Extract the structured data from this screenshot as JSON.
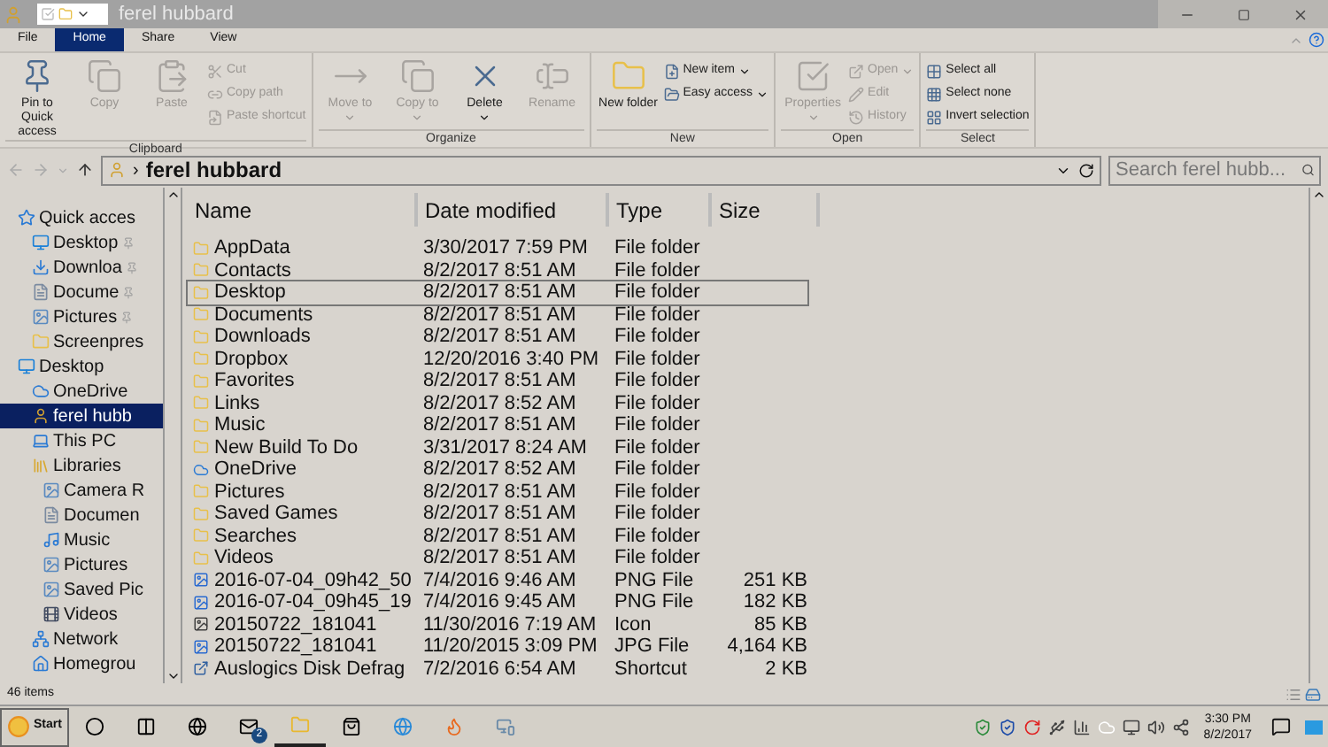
{
  "window": {
    "title": "ferel hubbard"
  },
  "ribbon_tabs": [
    {
      "label": "File",
      "selected": false
    },
    {
      "label": "Home",
      "selected": true
    },
    {
      "label": "Share",
      "selected": false
    },
    {
      "label": "View",
      "selected": false
    }
  ],
  "ribbon_groups": [
    {
      "label": "Clipboard",
      "commands": [
        {
          "kind": "large",
          "label": "Pin to Quick access",
          "disabled": false,
          "menu": false
        },
        {
          "kind": "large",
          "label": "Copy",
          "disabled": true,
          "menu": false
        },
        {
          "kind": "large",
          "label": "Paste",
          "disabled": true,
          "menu": false
        },
        {
          "kind": "small",
          "label": "Cut",
          "disabled": true,
          "menu": false
        },
        {
          "kind": "small",
          "label": "Copy path",
          "disabled": true,
          "menu": false
        },
        {
          "kind": "small",
          "label": "Paste shortcut",
          "disabled": true,
          "menu": false
        }
      ]
    },
    {
      "label": "Organize",
      "commands": [
        {
          "kind": "large",
          "label": "Move to",
          "disabled": true,
          "menu": true
        },
        {
          "kind": "large",
          "label": "Copy to",
          "disabled": true,
          "menu": true
        },
        {
          "kind": "large",
          "label": "Delete",
          "disabled": false,
          "menu": true
        },
        {
          "kind": "large",
          "label": "Rename",
          "disabled": true,
          "menu": false
        }
      ]
    },
    {
      "label": "New",
      "commands": [
        {
          "kind": "large",
          "label": "New folder",
          "disabled": false,
          "menu": false
        },
        {
          "kind": "small",
          "label": "New item",
          "disabled": false,
          "menu": true
        },
        {
          "kind": "small",
          "label": "Easy access",
          "disabled": false,
          "menu": true
        }
      ]
    },
    {
      "label": "Open",
      "commands": [
        {
          "kind": "large",
          "label": "Properties",
          "disabled": true,
          "menu": true
        },
        {
          "kind": "small",
          "label": "Open",
          "disabled": true,
          "menu": true
        },
        {
          "kind": "small",
          "label": "Edit",
          "disabled": true,
          "menu": false
        },
        {
          "kind": "small",
          "label": "History",
          "disabled": true,
          "menu": false
        }
      ]
    },
    {
      "label": "Select",
      "commands": [
        {
          "kind": "small",
          "label": "Select all",
          "disabled": false,
          "menu": false
        },
        {
          "kind": "small",
          "label": "Select none",
          "disabled": false,
          "menu": false
        },
        {
          "kind": "small",
          "label": "Invert selection",
          "disabled": false,
          "menu": false
        }
      ]
    }
  ],
  "address": {
    "separator": "›",
    "path": "ferel hubbard"
  },
  "search": {
    "placeholder": "Search ferel hubb..."
  },
  "nav_tree": [
    {
      "label": "Quick acces",
      "selected": false,
      "children": [
        {
          "label": "Desktop",
          "pinned": true,
          "selected": false
        },
        {
          "label": "Downloa",
          "pinned": true,
          "selected": false
        },
        {
          "label": "Docume",
          "pinned": true,
          "selected": false
        },
        {
          "label": "Pictures",
          "pinned": true,
          "selected": false
        },
        {
          "label": "Screenpres",
          "pinned": false,
          "selected": false
        }
      ]
    },
    {
      "label": "Desktop",
      "selected": false,
      "children": [
        {
          "label": "OneDrive",
          "selected": false
        },
        {
          "label": "ferel hubb",
          "selected": true
        },
        {
          "label": "This PC",
          "selected": false
        },
        {
          "label": "Libraries",
          "selected": false,
          "children": [
            {
              "label": "Camera R",
              "selected": false
            },
            {
              "label": "Documen",
              "selected": false
            },
            {
              "label": "Music",
              "selected": false
            },
            {
              "label": "Pictures",
              "selected": false
            },
            {
              "label": "Saved Pic",
              "selected": false
            },
            {
              "label": "Videos",
              "selected": false
            }
          ]
        },
        {
          "label": "Network",
          "selected": false
        },
        {
          "label": "Homegrou",
          "selected": false
        }
      ]
    }
  ],
  "table": {
    "columns": [
      "Name",
      "Date modified",
      "Type",
      "Size"
    ],
    "rows": [
      {
        "kind": "folder",
        "name": "AppData",
        "date": "3/30/2017 7:59 PM",
        "type": "File folder",
        "selected": false
      },
      {
        "kind": "folder",
        "name": "Contacts",
        "date": "8/2/2017 8:51 AM",
        "type": "File folder",
        "selected": false
      },
      {
        "kind": "folder",
        "name": "Desktop",
        "date": "8/2/2017 8:51 AM",
        "type": "File folder",
        "selected": true
      },
      {
        "kind": "folder",
        "name": "Documents",
        "date": "8/2/2017 8:51 AM",
        "type": "File folder",
        "selected": false
      },
      {
        "kind": "folder",
        "name": "Downloads",
        "date": "8/2/2017 8:51 AM",
        "type": "File folder",
        "selected": false
      },
      {
        "kind": "folder",
        "name": "Dropbox",
        "date": "12/20/2016 3:40 PM",
        "type": "File folder",
        "selected": false
      },
      {
        "kind": "folder",
        "name": "Favorites",
        "date": "8/2/2017 8:51 AM",
        "type": "File folder",
        "selected": false
      },
      {
        "kind": "folder",
        "name": "Links",
        "date": "8/2/2017 8:52 AM",
        "type": "File folder",
        "selected": false
      },
      {
        "kind": "folder",
        "name": "Music",
        "date": "8/2/2017 8:51 AM",
        "type": "File folder",
        "selected": false
      },
      {
        "kind": "folder",
        "name": "New Build To Do",
        "date": "3/31/2017 8:24 AM",
        "type": "File folder",
        "selected": false
      },
      {
        "kind": "cloud",
        "name": "OneDrive",
        "date": "8/2/2017 8:52 AM",
        "type": "File folder",
        "selected": false
      },
      {
        "kind": "folder",
        "name": "Pictures",
        "date": "8/2/2017 8:51 AM",
        "type": "File folder",
        "selected": false
      },
      {
        "kind": "folder",
        "name": "Saved Games",
        "date": "8/2/2017 8:51 AM",
        "type": "File folder",
        "selected": false
      },
      {
        "kind": "folder",
        "name": "Searches",
        "date": "8/2/2017 8:51 AM",
        "type": "File folder",
        "selected": false
      },
      {
        "kind": "folder",
        "name": "Videos",
        "date": "8/2/2017 8:51 AM",
        "type": "File folder",
        "selected": false
      },
      {
        "kind": "image",
        "name": "2016-07-04_09h42_50",
        "date": "7/4/2016 9:46 AM",
        "type": "PNG File",
        "size": "251 KB",
        "selected": false
      },
      {
        "kind": "image",
        "name": "2016-07-04_09h45_19",
        "date": "7/4/2016 9:45 AM",
        "type": "PNG File",
        "size": "182 KB",
        "selected": false
      },
      {
        "kind": "icon",
        "name": "20150722_181041",
        "date": "11/30/2016 7:19 AM",
        "type": "Icon",
        "size": "85 KB",
        "selected": false
      },
      {
        "kind": "image",
        "name": "20150722_181041",
        "date": "11/20/2015 3:09 PM",
        "type": "JPG File",
        "size": "4,164 KB",
        "selected": false
      },
      {
        "kind": "shortcut",
        "name": "Auslogics Disk Defrag",
        "date": "7/2/2016 6:54 AM",
        "type": "Shortcut",
        "size": "2 KB",
        "selected": false
      }
    ]
  },
  "status_bar": {
    "items": "46 items"
  },
  "taskbar": {
    "start": "Start",
    "apps": [
      {
        "active": false
      },
      {
        "active": false
      },
      {
        "active": false
      },
      {
        "active": false,
        "badge": "2"
      },
      {
        "active": true
      },
      {
        "active": false
      },
      {
        "active": false
      },
      {
        "active": false
      },
      {
        "active": false
      }
    ],
    "time": "3:30 PM",
    "date": "8/2/2017"
  }
}
